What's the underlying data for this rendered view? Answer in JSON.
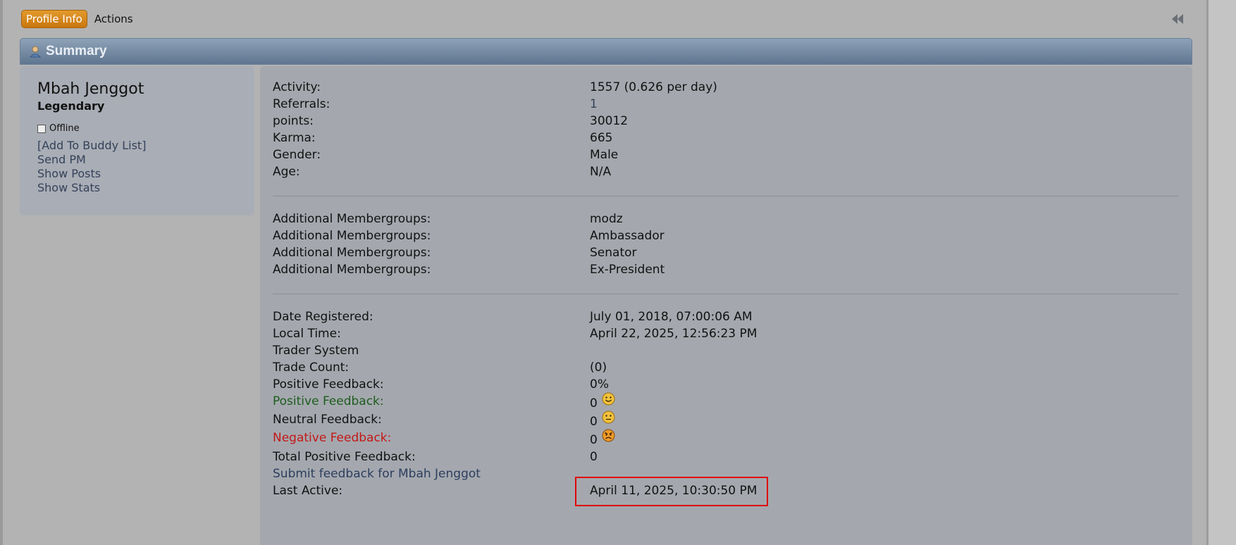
{
  "topbar": {
    "profile_info_tab": "Profile Info",
    "actions_tab": "Actions",
    "collapse_icon": "double-chevron-left-icon"
  },
  "summary": {
    "title": "Summary",
    "icon": "user-icon"
  },
  "profile": {
    "name": "Mbah Jenggot",
    "rank": "Legendary",
    "status": "Offline",
    "add_buddy": "[Add To Buddy List]",
    "send_pm": "Send PM",
    "show_posts": "Show Posts",
    "show_stats": "Show Stats"
  },
  "stats": {
    "activity_label": "Activity:",
    "activity_value": "1557 (0.626 per day)",
    "referrals_label": "Referrals:",
    "referrals_value": "1",
    "points_label": "points:",
    "points_value": "30012",
    "karma_label": "Karma:",
    "karma_value": "665",
    "gender_label": "Gender:",
    "gender_value": "Male",
    "age_label": "Age:",
    "age_value": "N/A"
  },
  "membergroups": [
    {
      "label": "Additional Membergroups:",
      "value": "modz"
    },
    {
      "label": "Additional Membergroups:",
      "value": "Ambassador"
    },
    {
      "label": "Additional Membergroups:",
      "value": "Senator"
    },
    {
      "label": "Additional Membergroups:",
      "value": "Ex-President"
    }
  ],
  "details": {
    "registered_label": "Date Registered:",
    "registered_value": "July 01, 2018, 07:00:06 AM",
    "local_time_label": "Local Time:",
    "local_time_value": "April 22, 2025, 12:56:23 PM",
    "trader_system_label": "Trader System",
    "trade_count_label": "Trade Count:",
    "trade_count_value": "(0)",
    "positive_pct_label": "Positive Feedback:",
    "positive_pct_value": "0%",
    "positive_label": "Positive Feedback:",
    "positive_value": "0",
    "positive_icon": "smiley-face-icon",
    "neutral_label": "Neutral Feedback:",
    "neutral_value": "0",
    "neutral_icon": "neutral-face-icon",
    "negative_label": "Negative Feedback:",
    "negative_value": "0",
    "negative_icon": "angry-face-icon",
    "total_positive_label": "Total Positive Feedback:",
    "total_positive_value": "0",
    "submit_feedback": "Submit feedback for Mbah Jenggot",
    "last_active_label": "Last Active:",
    "last_active_value": "April 11, 2025, 10:30:50 PM"
  },
  "colors": {
    "tab_active": "#d9891c",
    "summary_bar": "#6f8399",
    "panel": "#a4a8ae",
    "positive_text": "#1e5c1e",
    "negative_text": "#c41818",
    "highlight": "#e00000"
  }
}
